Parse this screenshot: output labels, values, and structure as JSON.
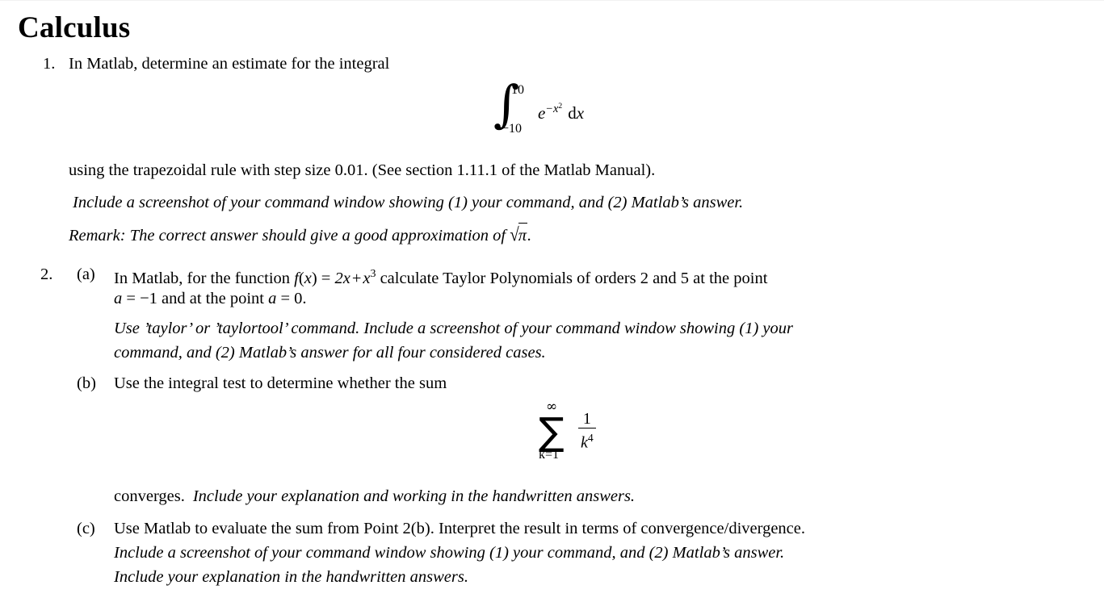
{
  "document": {
    "title": "Calculus"
  },
  "items": {
    "item1": {
      "marker": "1.",
      "line1": "In Matlab, determine an estimate for the integral",
      "formula": {
        "kind": "definite-integral",
        "integral_sign": "∫",
        "upper_limit": "10",
        "lower_limit": "−10",
        "integrand_base": "e",
        "integrand_exponent": "−x",
        "integrand_exponent_power": "2",
        "differential": "dx",
        "latex": "\\int_{-10}^{10} e^{-x^2}\\,\\mathrm{d}x"
      },
      "line2": "using the trapezoidal rule with step size 0.01.  (See section 1.11.1 of the Matlab Manual).",
      "line3_italic": "Include a screenshot of your command window showing (1) your command, and (2) Matlab’s answer.",
      "line4_italic_prefix": "Remark: The correct answer should give a good approximation of ",
      "line4_sqrt_radical": "√",
      "line4_sqrt_arg": "π",
      "line4_italic_suffix": "."
    },
    "item2": {
      "marker": "2.",
      "sub_a": {
        "marker": "(a)",
        "line1_part1": "In Matlab, for the function ",
        "line1_fx": "f",
        "line1_paren_open": "(",
        "line1_x": "x",
        "line1_paren_close": ")",
        "line1_equals": " = ",
        "line1_term1": "2x",
        "line1_plus": "+",
        "line1_term2_base": "x",
        "line1_term2_exp": "3",
        "line1_part2": " calculate Taylor Polynomials of orders 2 and 5 at the point",
        "line2_a": "a",
        "line2_eq1": " = ",
        "line2_val1": "−1",
        "line2_mid": " and at the point ",
        "line2_a2": "a",
        "line2_eq2": " = ",
        "line2_val2": "0",
        "line2_end": ".",
        "note_line1_italic": "Use ’taylor’ or ’taylortool’ command. Include a screenshot of your command window showing (1) your",
        "note_line2_italic": "command, and (2) Matlab’s answer for all four considered cases."
      },
      "sub_b": {
        "marker": "(b)",
        "line1": "Use the integral test to determine whether the sum",
        "formula": {
          "kind": "infinite-series",
          "sum_sign": "∑",
          "upper_limit": "∞",
          "lower_limit": "k=1",
          "numerator": "1",
          "denominator_base": "k",
          "denominator_exponent": "4",
          "latex": "\\sum_{k=1}^{\\infty} \\frac{1}{k^{4}}"
        },
        "line2_normal": "converges.",
        "line2_italic": "Include your explanation and working in the handwritten answers."
      },
      "sub_c": {
        "marker": "(c)",
        "line1": "Use Matlab to evaluate the sum from Point 2(b).  Interpret the result in terms of convergence/divergence.",
        "line2_italic": "Include a screenshot of your command window showing (1) your command, and (2) Matlab’s answer.",
        "line3_italic": "Include your explanation in the handwritten answers."
      }
    }
  },
  "colors": {
    "page_background": "#ffffff",
    "text": "#000000",
    "top_hairline": "#f1f1f1"
  }
}
